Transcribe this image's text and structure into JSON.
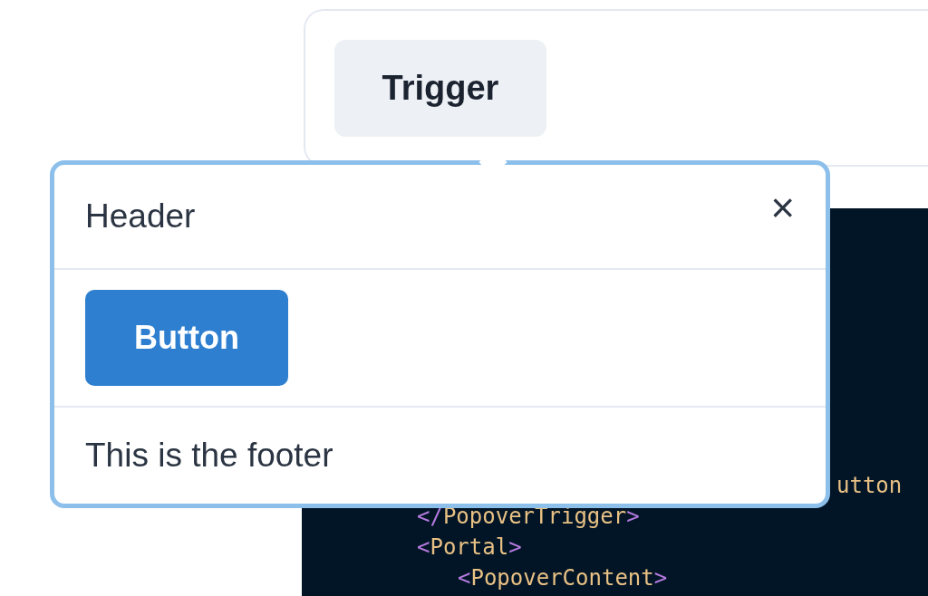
{
  "trigger": {
    "label": "Trigger"
  },
  "popover": {
    "header": "Header",
    "close": "×",
    "button": "Button",
    "footer": "This is the footer"
  },
  "code_lines": [
    {
      "tokens": [
        {
          "kind": "name",
          "text": "utton"
        }
      ]
    },
    {
      "tokens": [
        {
          "kind": "punct",
          "text": "</"
        },
        {
          "kind": "name",
          "text": "PopoverTrigger"
        },
        {
          "kind": "punct",
          "text": ">"
        }
      ]
    },
    {
      "tokens": [
        {
          "kind": "punct",
          "text": "<"
        },
        {
          "kind": "name",
          "text": "Portal"
        },
        {
          "kind": "punct",
          "text": ">"
        }
      ]
    },
    {
      "tokens": [
        {
          "kind": "punct",
          "text": "<"
        },
        {
          "kind": "name",
          "text": "PopoverContent"
        },
        {
          "kind": "punct",
          "text": ">"
        }
      ]
    }
  ]
}
